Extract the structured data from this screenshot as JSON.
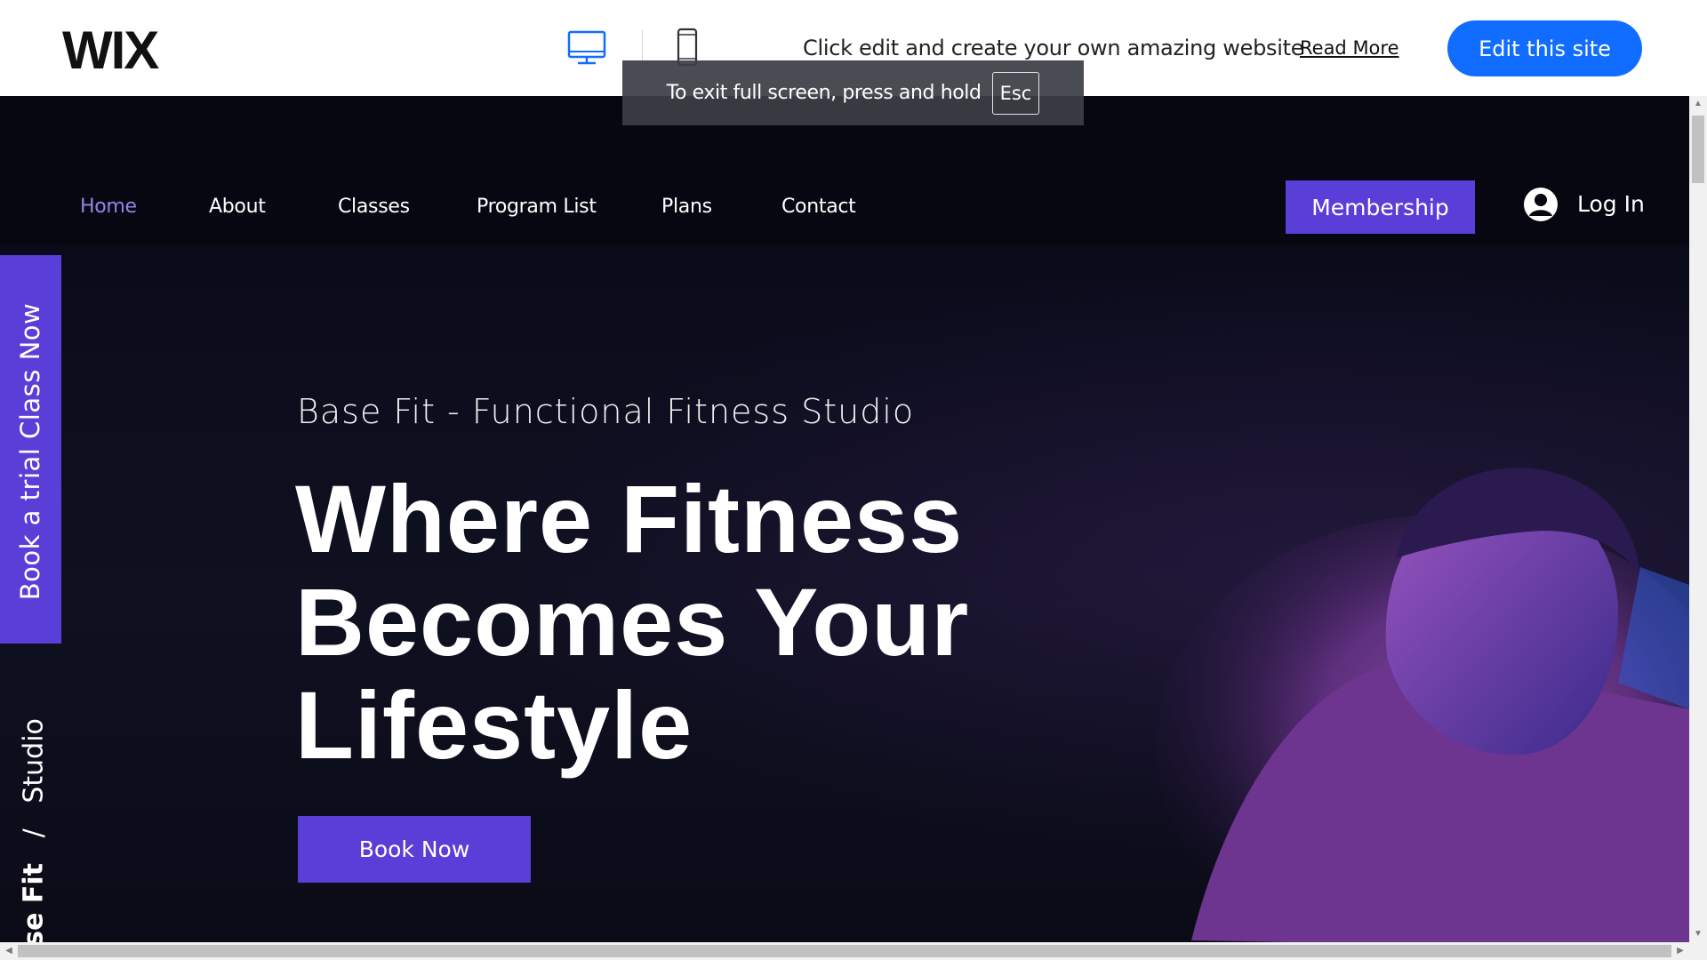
{
  "wix_bar": {
    "logo": "WIX",
    "promo_text": "Click edit and create your own amazing website",
    "read_more": "Read More",
    "edit_button": "Edit this site",
    "accent": "#116dff"
  },
  "fullscreen_notice": {
    "text": "To exit full screen, press and hold",
    "key": "Esc"
  },
  "site": {
    "nav": [
      {
        "label": "Home",
        "active": true
      },
      {
        "label": "About"
      },
      {
        "label": "Classes"
      },
      {
        "label": "Program List"
      },
      {
        "label": "Plans"
      },
      {
        "label": "Contact"
      }
    ],
    "membership_button": "Membership",
    "login_label": "Log In",
    "side_tab": "Book a trial Class Now",
    "side_brand": {
      "bold": "Base Fit",
      "sep": "/",
      "rest": "Studio"
    },
    "hero": {
      "subtitle": "Base Fit - Functional Fitness Studio",
      "headline_lines": [
        "Where Fitness",
        "Becomes Your",
        "Lifestyle"
      ],
      "cta": "Book Now"
    },
    "colors": {
      "brand_purple": "#5a3ed8",
      "active_nav": "#8f86e8",
      "background": "#0b0c1c"
    }
  }
}
